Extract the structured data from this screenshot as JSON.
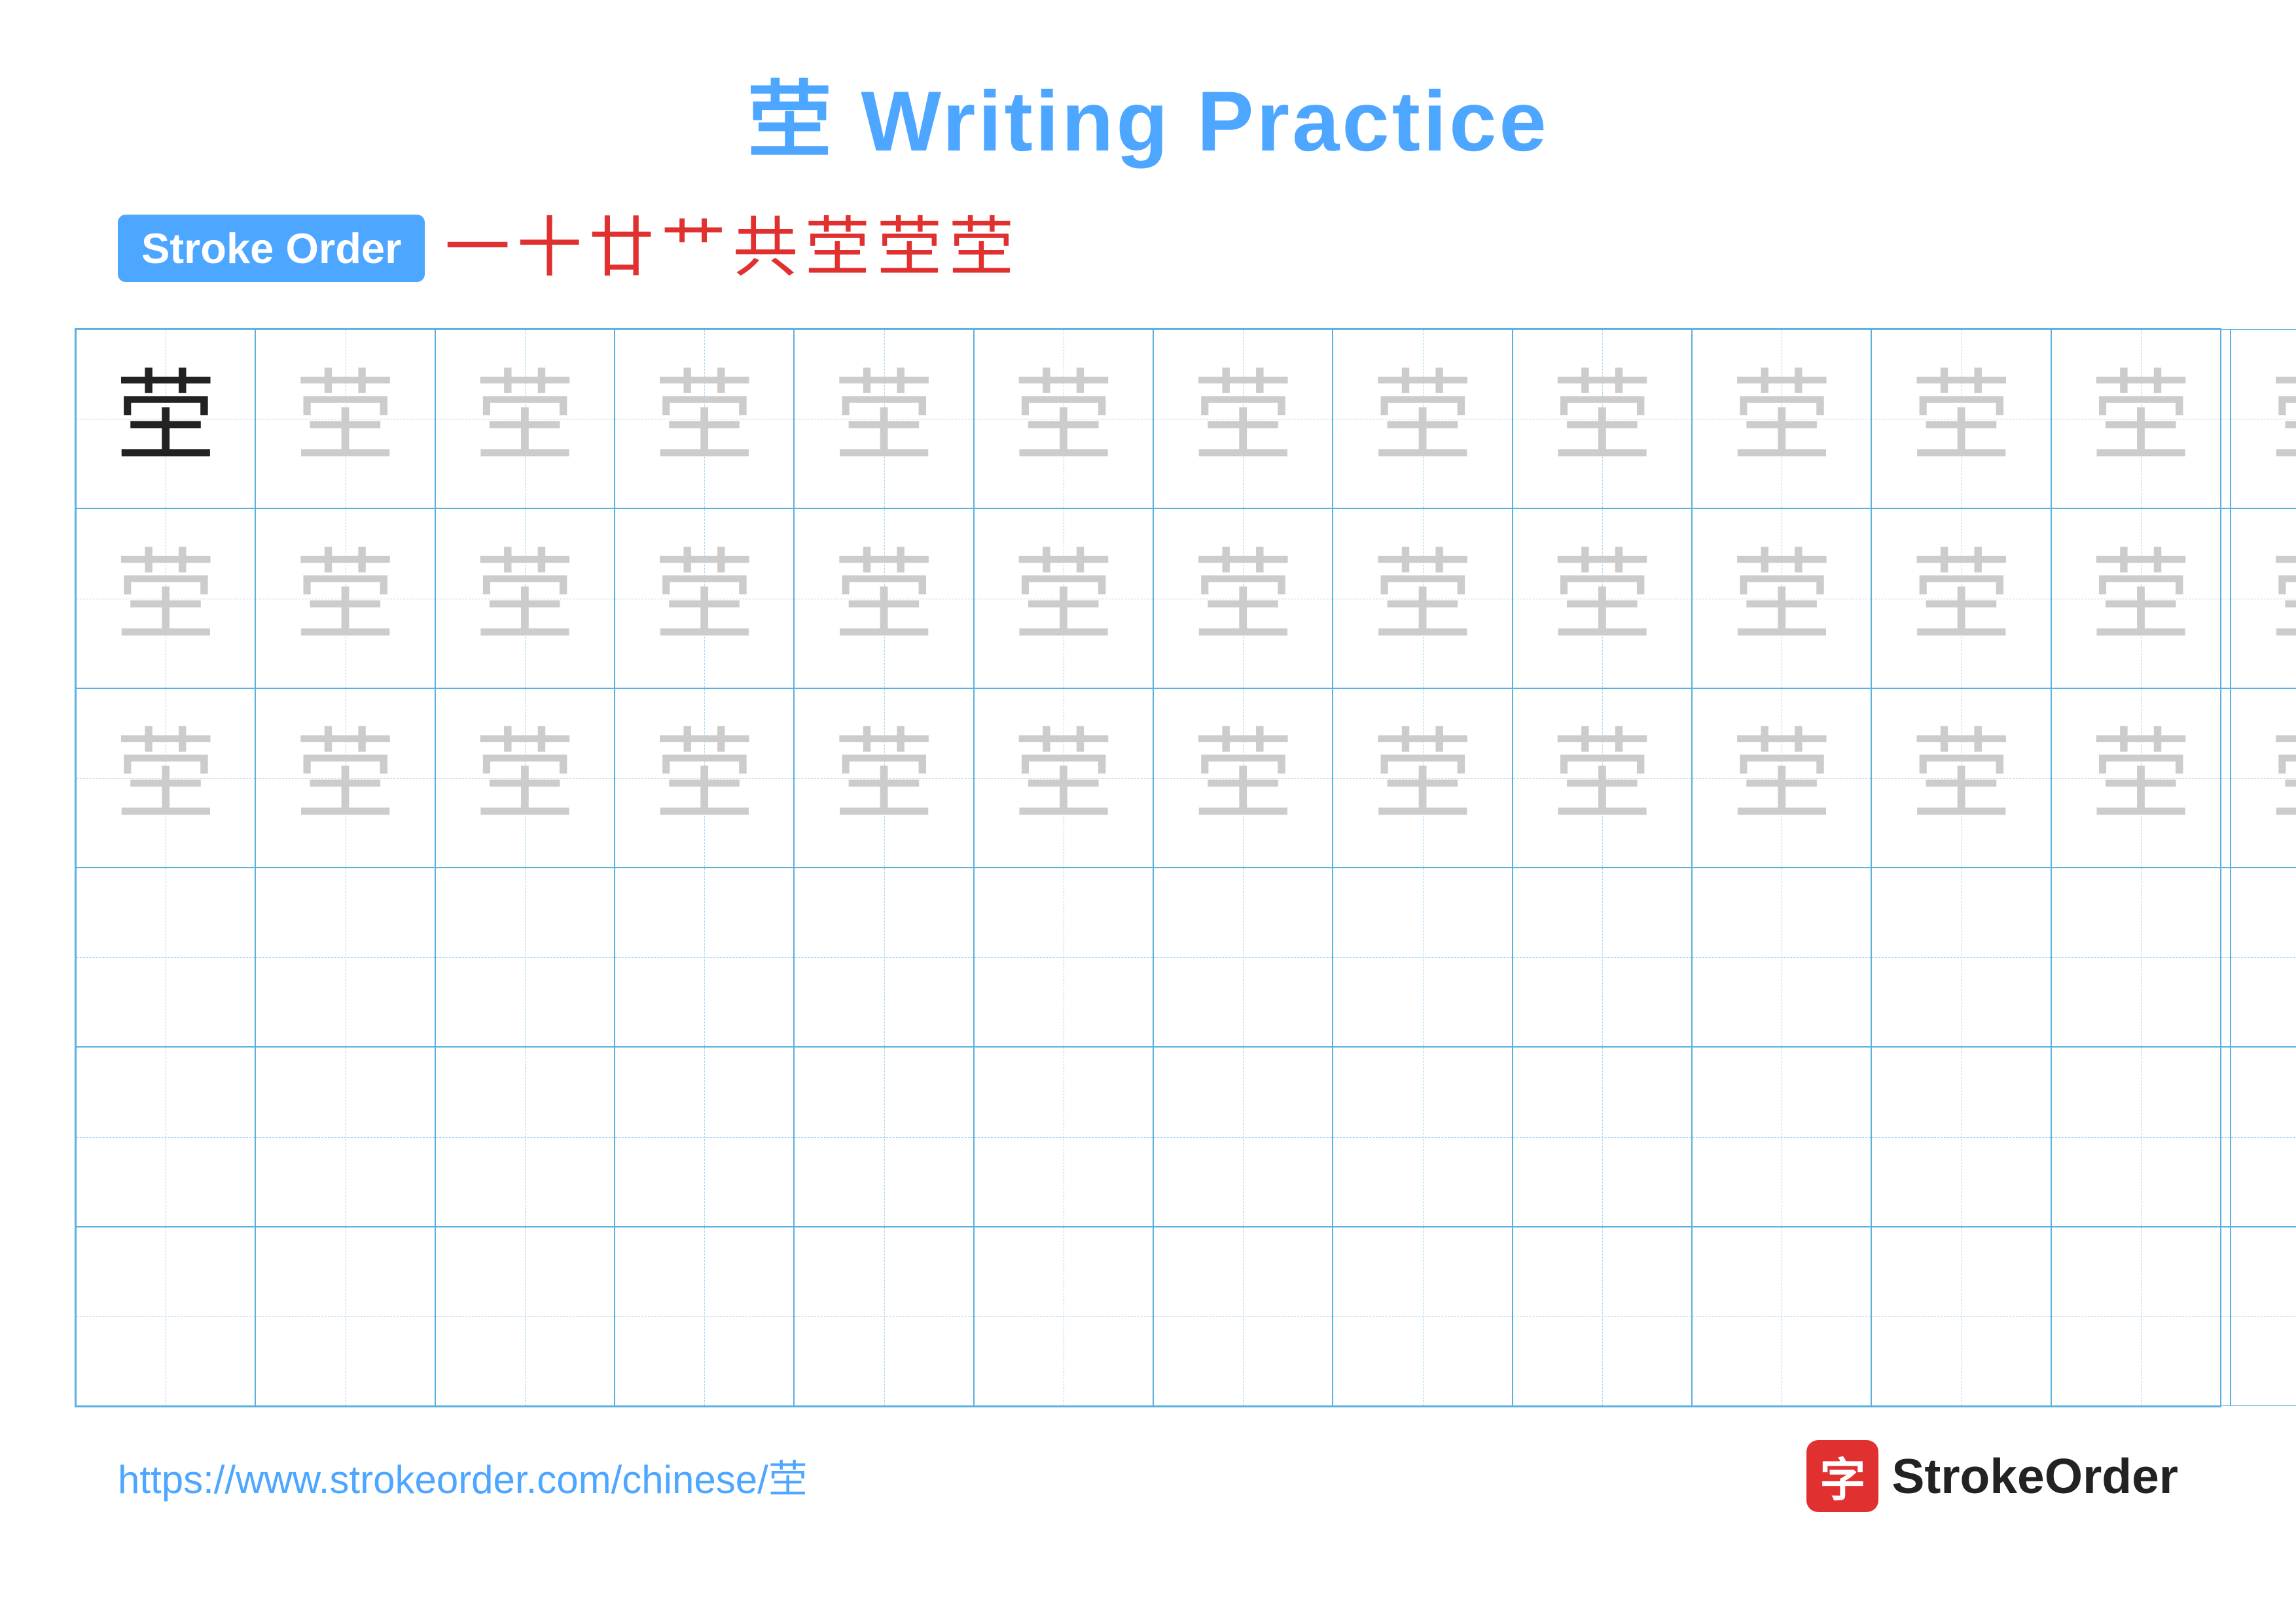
{
  "title": {
    "char": "茔",
    "text": " Writing Practice"
  },
  "stroke_order": {
    "badge_label": "Stroke Order",
    "strokes": [
      "一",
      "十",
      "廾",
      "廾",
      "共",
      "茔",
      "茔",
      "茔"
    ]
  },
  "grid": {
    "rows": 6,
    "cols": 13,
    "practice_char": "茔",
    "filled_rows": 3,
    "first_cell_dark": true
  },
  "footer": {
    "url": "https://www.strokeorder.com/chinese/茔",
    "logo_char": "字",
    "logo_name": "StrokeOrder"
  }
}
